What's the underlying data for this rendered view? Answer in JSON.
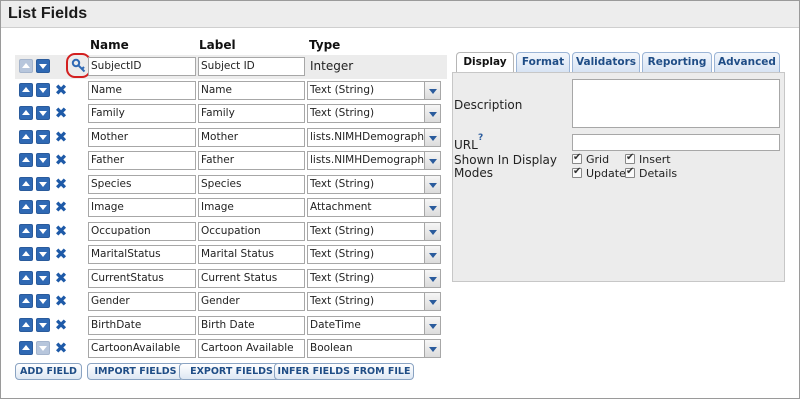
{
  "title": "List Fields",
  "columns": {
    "name": "Name",
    "label": "Label",
    "type": "Type"
  },
  "fields": [
    {
      "name": "SubjectID",
      "label": "Subject ID",
      "type": "Integer",
      "is_key": true,
      "up_enabled": false,
      "down_enabled": true,
      "deletable": false
    },
    {
      "name": "Name",
      "label": "Name",
      "type": "Text (String)",
      "is_key": false,
      "up_enabled": true,
      "down_enabled": true,
      "deletable": true
    },
    {
      "name": "Family",
      "label": "Family",
      "type": "Text (String)",
      "is_key": false,
      "up_enabled": true,
      "down_enabled": true,
      "deletable": true
    },
    {
      "name": "Mother",
      "label": "Mother",
      "type": "lists.NIMHDemographics",
      "is_key": false,
      "up_enabled": true,
      "down_enabled": true,
      "deletable": true
    },
    {
      "name": "Father",
      "label": "Father",
      "type": "lists.NIMHDemographics",
      "is_key": false,
      "up_enabled": true,
      "down_enabled": true,
      "deletable": true
    },
    {
      "name": "Species",
      "label": "Species",
      "type": "Text (String)",
      "is_key": false,
      "up_enabled": true,
      "down_enabled": true,
      "deletable": true
    },
    {
      "name": "Image",
      "label": "Image",
      "type": "Attachment",
      "is_key": false,
      "up_enabled": true,
      "down_enabled": true,
      "deletable": true
    },
    {
      "name": "Occupation",
      "label": "Occupation",
      "type": "Text (String)",
      "is_key": false,
      "up_enabled": true,
      "down_enabled": true,
      "deletable": true
    },
    {
      "name": "MaritalStatus",
      "label": "Marital Status",
      "type": "Text (String)",
      "is_key": false,
      "up_enabled": true,
      "down_enabled": true,
      "deletable": true
    },
    {
      "name": "CurrentStatus",
      "label": "Current Status",
      "type": "Text (String)",
      "is_key": false,
      "up_enabled": true,
      "down_enabled": true,
      "deletable": true
    },
    {
      "name": "Gender",
      "label": "Gender",
      "type": "Text (String)",
      "is_key": false,
      "up_enabled": true,
      "down_enabled": true,
      "deletable": true
    },
    {
      "name": "BirthDate",
      "label": "Birth Date",
      "type": "DateTime",
      "is_key": false,
      "up_enabled": true,
      "down_enabled": true,
      "deletable": true
    },
    {
      "name": "CartoonAvailable",
      "label": "Cartoon Available",
      "type": "Boolean",
      "is_key": false,
      "up_enabled": true,
      "down_enabled": false,
      "deletable": true
    }
  ],
  "actions": {
    "add_field": "ADD FIELD",
    "import_fields": "IMPORT FIELDS",
    "export_fields": "EXPORT FIELDS",
    "infer_fields": "INFER FIELDS FROM FILE"
  },
  "properties": {
    "tabs": [
      "Display",
      "Format",
      "Validators",
      "Reporting",
      "Advanced"
    ],
    "active_tab": "Display",
    "description_label": "Description",
    "description_value": "",
    "url_label": "URL",
    "url_help": "?",
    "url_value": "",
    "shown_in_label_line1": "Shown In Display",
    "shown_in_label_line2": "Modes",
    "modes": [
      {
        "label": "Grid",
        "checked": true
      },
      {
        "label": "Insert",
        "checked": true
      },
      {
        "label": "Update",
        "checked": true
      },
      {
        "label": "Details",
        "checked": true
      }
    ]
  },
  "colors": {
    "accent": "#2f69b4",
    "key_highlight": "#d32020",
    "tab_text": "#1f4d86"
  }
}
